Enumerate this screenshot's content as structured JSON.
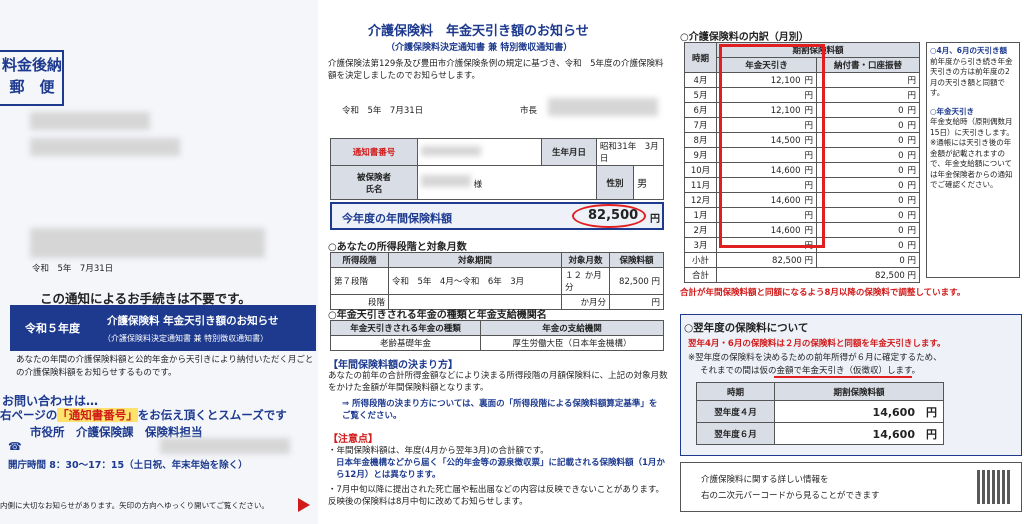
{
  "left": {
    "postage": "料金後納\n郵　便",
    "date": "令和　5年　7月31日",
    "no_procedure": "この通知によるお手続きは不要です。",
    "box_era": "令和５年度",
    "box_title": "介護保険料 年金天引き額のお知らせ",
    "box_subtitle": "（介護保険料決定通知書 兼 特別徴収通知書）",
    "body": "あなたの年間の介護保険料額と公的年金から天引きにより納付いただく月ごとの介護保険料額をお知らせするものです。",
    "inquiry_title": "お問い合わせは…",
    "inquiry_line_prefix": "右ページの",
    "inquiry_highlight": "「通知書番号」",
    "inquiry_line_suffix": "をお伝え頂くとスムーズです",
    "office": "市役所　介護保険課　保険料担当",
    "phone_icon": "☎",
    "hours": "開庁時間 8：30～17：15（土日祝、年末年始を除く）",
    "footer": "内側に大切なお知らせがあります。矢印の方向へゆっくり開いてご覧ください。"
  },
  "middle": {
    "title": "介護保険料　年金天引き額のお知らせ",
    "subtitle": "（介護保険料決定通知書 兼 特別徴収通知書）",
    "intro": "介護保険法第129条及び豊田市介護保険条例の規定に基づき、令和　5年度の介護保険料額を決定しましたのでお知らせします。",
    "date": "令和　5年　7月31日",
    "mayor": "市長",
    "notice_no_label": "通知書番号",
    "dob_label": "生年月日",
    "dob_value": "昭和31年　3月　日",
    "insured_label": "被保険者\n氏名",
    "honorific": "様",
    "sex_label": "性別",
    "sex_value": "男",
    "annual_label": "今年度の年間保険料額",
    "annual_value": "82,500",
    "yen": "円",
    "sec1_title": "○あなたの所得段階と対象月数",
    "sec1_headers": [
      "所得段階",
      "対象期間",
      "対象月数",
      "保険料額"
    ],
    "sec1_row1": [
      "第７段階",
      "令和　5年　4月～令和　6年　3月",
      "１２ か月分",
      "82,500 円"
    ],
    "sec1_row2": [
      "段階",
      "",
      "か月分",
      "円"
    ],
    "sec2_title": "○年金天引きされる年金の種類と年金支給機関名",
    "sec2_headers": [
      "年金天引きされる年金の種類",
      "年金の支給機関"
    ],
    "sec2_row": [
      "老齢基礎年金",
      "厚生労働大臣（日本年金機構）"
    ],
    "sec3_title": "【年間保険料額の決まり方】",
    "sec3_body": "あなたの前年の合計所得金額などにより決まる所得段階の月額保険料に、上記の対象月数をかけた金額が年間保険料額となります。",
    "sec3_arrow": "⇒ 所得段階の決まり方については、裏面の「所得段階による保険料額算定基準」をご覧ください。",
    "note_title": "【注意点】",
    "note1": "・年間保険料額は、年度(4月から翌年3月)の合計額です。",
    "note2": "日本年金機構などから届く「公的年金等の源泉徴収票」に記載される保険料額（1月から12月）とは異なります。",
    "note3": "・7月中旬以降に提出された死亡届や転出届などの内容は反映できないことがあります。反映後の保険料は8月中旬に改めてお知らせします。"
  },
  "right": {
    "title": "○介護保険料の内訳（月別）",
    "col_period": "時期",
    "col_group": "期割保険料額",
    "col_pension": "年金天引き",
    "col_other": "納付書・口座振替",
    "yen": "円",
    "months": [
      {
        "m": "4月",
        "p": "12,100",
        "o": ""
      },
      {
        "m": "5月",
        "p": "",
        "o": ""
      },
      {
        "m": "6月",
        "p": "12,100",
        "o": "0"
      },
      {
        "m": "7月",
        "p": "",
        "o": "0"
      },
      {
        "m": "8月",
        "p": "14,500",
        "o": "0"
      },
      {
        "m": "9月",
        "p": "",
        "o": "0"
      },
      {
        "m": "10月",
        "p": "14,600",
        "o": "0"
      },
      {
        "m": "11月",
        "p": "",
        "o": "0"
      },
      {
        "m": "12月",
        "p": "14,600",
        "o": "0"
      },
      {
        "m": "1月",
        "p": "",
        "o": "0"
      },
      {
        "m": "2月",
        "p": "14,600",
        "o": "0"
      },
      {
        "m": "3月",
        "p": "",
        "o": "0"
      }
    ],
    "subtotal_label": "小計",
    "subtotal_p": "82,500",
    "subtotal_o": "0",
    "total_label": "合計",
    "total_value": "82,500",
    "side1_title": "○4月、6月の天引き額",
    "side1_body": "前年度から引き続き年金天引きの方は前年度の2月の天引き額と同額です。",
    "side2_title": "○年金天引き",
    "side2_body": "年金支給時（原則偶数月15日）に天引きします。※通帳には天引き後の年金額が記載されますので、年金支給額については年金保険者からの通知でご確認ください。",
    "red_note": "合計が年間保険料額と同額になるよう8月以降の保険料で調整しています。",
    "next_title": "○翌年度の保険料について",
    "next_red": "翌年4月・6月の保険料は２月の保険料と同額を年金天引きします。",
    "next_body1": "※翌年度の保険料を決めるための前年所得が６月に確定するため、",
    "next_body2": "それまでの間は仮の金額で年金天引き（仮徴収）します。",
    "next_headers": [
      "時期",
      "期割保険料額"
    ],
    "next_rows": [
      [
        "翌年度４月",
        "14,600"
      ],
      [
        "翌年度６月",
        "14,600"
      ]
    ],
    "qr_text1": "介護保険料に関する詳しい情報を",
    "qr_text2": "右の二次元バーコードから見ることができます",
    "colors": {
      "navy": "#1d3a8f",
      "red": "#d11a1a",
      "highlight": "#e02020"
    }
  }
}
